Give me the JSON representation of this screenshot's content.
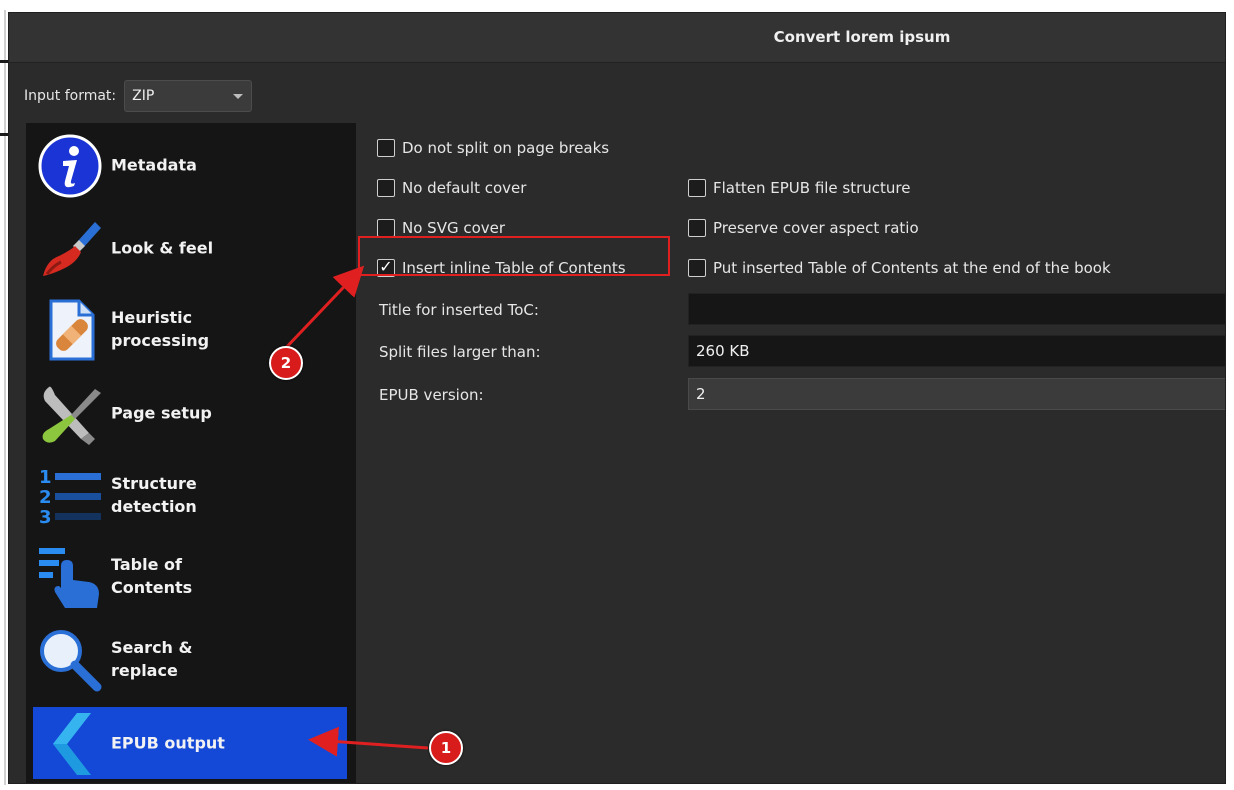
{
  "window": {
    "title": "Convert lorem ipsum"
  },
  "input_format": {
    "label": "Input format:",
    "value": "ZIP"
  },
  "sidebar": {
    "items": [
      {
        "label": "Metadata",
        "icon": "info-icon"
      },
      {
        "label": "Look & feel",
        "icon": "paintbrush-icon"
      },
      {
        "label": "Heuristic\nprocessing",
        "icon": "document-bandage-icon"
      },
      {
        "label": "Page setup",
        "icon": "wrench-screwdriver-icon"
      },
      {
        "label": "Structure\ndetection",
        "icon": "numbered-list-icon"
      },
      {
        "label": "Table of\nContents",
        "icon": "toc-hand-icon"
      },
      {
        "label": "Search &\nreplace",
        "icon": "magnifier-icon"
      },
      {
        "label": "EPUB output",
        "icon": "chevron-left-icon",
        "active": true
      }
    ]
  },
  "options": {
    "no_split": {
      "label": "Do not split on page breaks",
      "checked": false
    },
    "no_default_cover": {
      "label": "No default cover",
      "checked": false
    },
    "flatten": {
      "label": "Flatten EPUB file structure",
      "checked": false
    },
    "no_svg_cover": {
      "label": "No SVG cover",
      "checked": false
    },
    "preserve_aspect": {
      "label": "Preserve cover aspect ratio",
      "checked": false
    },
    "insert_toc": {
      "label": "Insert inline Table of Contents",
      "checked": true
    },
    "toc_at_end": {
      "label": "Put inserted Table of Contents at the end of the book",
      "checked": false
    }
  },
  "fields": {
    "toc_title": {
      "label": "Title for inserted ToC:",
      "value": ""
    },
    "split_size": {
      "label": "Split files larger than:",
      "value": "260 KB"
    },
    "epub_version": {
      "label": "EPUB version:",
      "value": "2"
    }
  },
  "annotations": {
    "badge1": "1",
    "badge2": "2"
  },
  "colors": {
    "accent": "#1449d8",
    "annotation_red": "#d81c1c"
  }
}
